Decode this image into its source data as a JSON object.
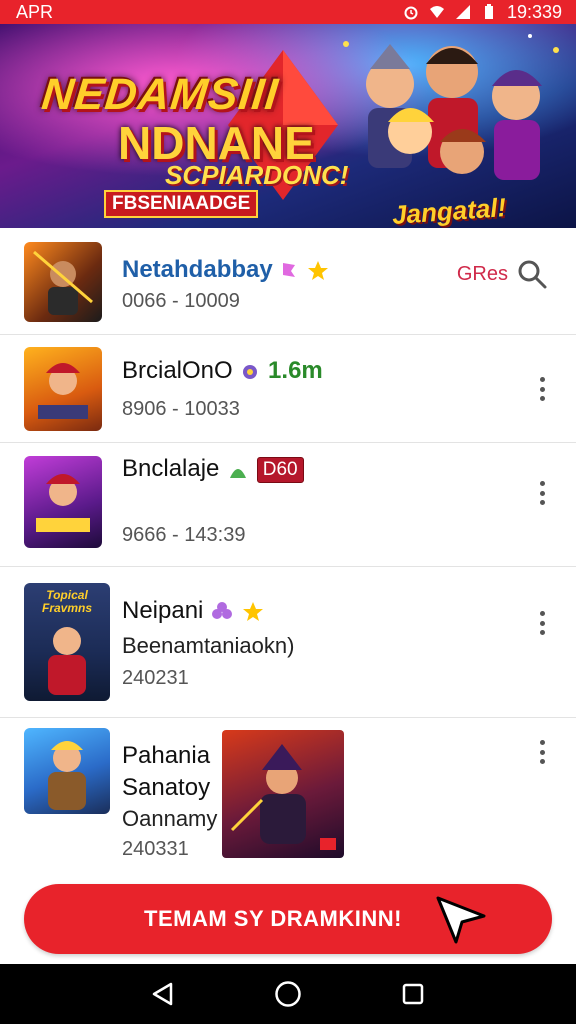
{
  "status_bar": {
    "left_text": "APR",
    "time": "19:339"
  },
  "banner": {
    "title_line1": "NEDAMSIII",
    "title_line2": "NDNANE",
    "title_line3": "SCPIARDONC!",
    "tag": "FBSENIAADGE",
    "badge": "Jangatal!"
  },
  "list": {
    "items": [
      {
        "title": "Netahdabbay",
        "subtitle": "0066 - 10009",
        "action_label": "GRes",
        "title_color": "#1f5fa8"
      },
      {
        "title": "BrcialOnO",
        "subtitle": "8906 - 10033",
        "stat": "1.6m"
      },
      {
        "title": "Bnclalaje",
        "subtitle": "9666 - 143:39",
        "tag": "D60"
      },
      {
        "title": "Neipani",
        "subtitle": "Beenamtaniaokn)",
        "meta": "240231",
        "thumb_text": "Topical Fravmns"
      },
      {
        "title_line1": "Pahania",
        "title_line2": "Sanatoy",
        "subtitle": "Oannamy",
        "meta": "240331"
      }
    ]
  },
  "cta": {
    "label": "TEMAM SY DRAMKINN!"
  },
  "colors": {
    "primary": "#e8232b",
    "nav_bg": "#000000",
    "link_blue": "#1f5fa8"
  },
  "icons": [
    "alarm-icon",
    "wifi-icon",
    "signal-icon",
    "battery-icon",
    "search-icon",
    "more-vertical-icon",
    "star-icon",
    "back-icon",
    "home-icon",
    "recents-icon",
    "arrow-cursor-icon"
  ]
}
